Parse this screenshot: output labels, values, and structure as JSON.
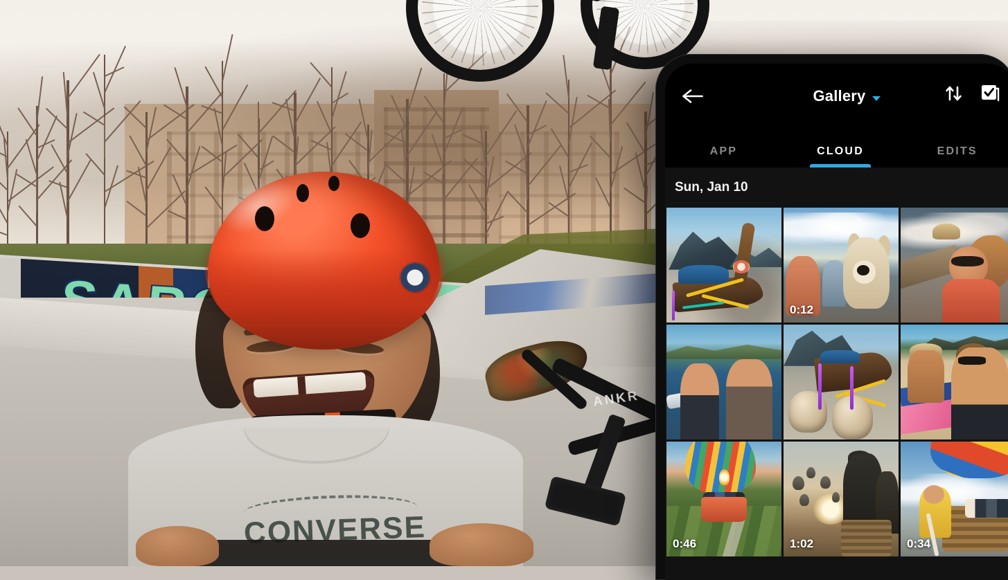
{
  "app": {
    "header": {
      "back_icon": "back-arrow-icon",
      "title": "Gallery",
      "title_caret_icon": "chevron-down-icon",
      "sort_icon": "sort-arrows-icon",
      "select_icon": "select-multiple-icon"
    },
    "tabs": [
      {
        "label": "APP",
        "active": false
      },
      {
        "label": "CLOUD",
        "active": true
      },
      {
        "label": "EDITS",
        "active": false
      }
    ],
    "accent_color": "#2daae4",
    "background_color": "#000000",
    "content_background_color": "#121212",
    "section": {
      "date_label": "Sun, Jan 10"
    },
    "media": [
      {
        "scene": "t-boat",
        "duration": ""
      },
      {
        "scene": "t-dog",
        "duration": "0:12"
      },
      {
        "scene": "t-woman",
        "duration": ""
      },
      {
        "scene": "t-couple",
        "duration": ""
      },
      {
        "scene": "t-coco",
        "duration": ""
      },
      {
        "scene": "t-beach",
        "duration": ""
      },
      {
        "scene": "t-balloon1",
        "duration": "0:46"
      },
      {
        "scene": "t-sunrise",
        "duration": "1:02"
      },
      {
        "scene": "t-balloon2",
        "duration": "0:34"
      }
    ]
  },
  "background_photo": {
    "shirt_text": "CONVERSE",
    "bike_logo": "ANKR",
    "graffiti_letters": [
      "S",
      "A",
      "R",
      "C"
    ]
  }
}
